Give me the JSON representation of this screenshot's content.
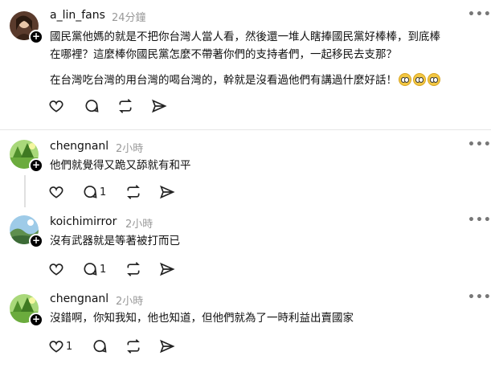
{
  "posts": [
    {
      "username": "a_lin_fans",
      "time": "24分鐘",
      "lines": [
        "國民黨他媽的就是不把你台灣人當人看，然後還一堆人瞎捧國民黨好棒棒，到底棒",
        "在哪裡？這麼棒你國民黨怎麼不帶著你們的支持者們，一起移民去支那？"
      ],
      "paragraph2": "在台灣吃台灣的用台灣的喝台灣的，幹就是沒看過他們有講過什麼好話！",
      "emoji_icons": [
        "flushed-face-icon",
        "flushed-face-icon",
        "flushed-face-icon"
      ]
    },
    {
      "username": "chengnanl",
      "time": "2小時",
      "text": "他們就覺得又跪又舔就有和平",
      "reply_count": "1"
    },
    {
      "username": "koichimirror",
      "time": "2小時",
      "text": "沒有武器就是等著被打而已",
      "reply_count": "1"
    },
    {
      "username": "chengnanl",
      "time": "2小時",
      "text": "沒錯啊，你知我知，他也知道，但他們就為了一時利益出賣國家",
      "like_count": "1"
    }
  ],
  "more_label": "•••",
  "plus_label": "+",
  "colors": {
    "divider": "#e6e6e6",
    "muted": "#999999",
    "accent": "#000000"
  }
}
